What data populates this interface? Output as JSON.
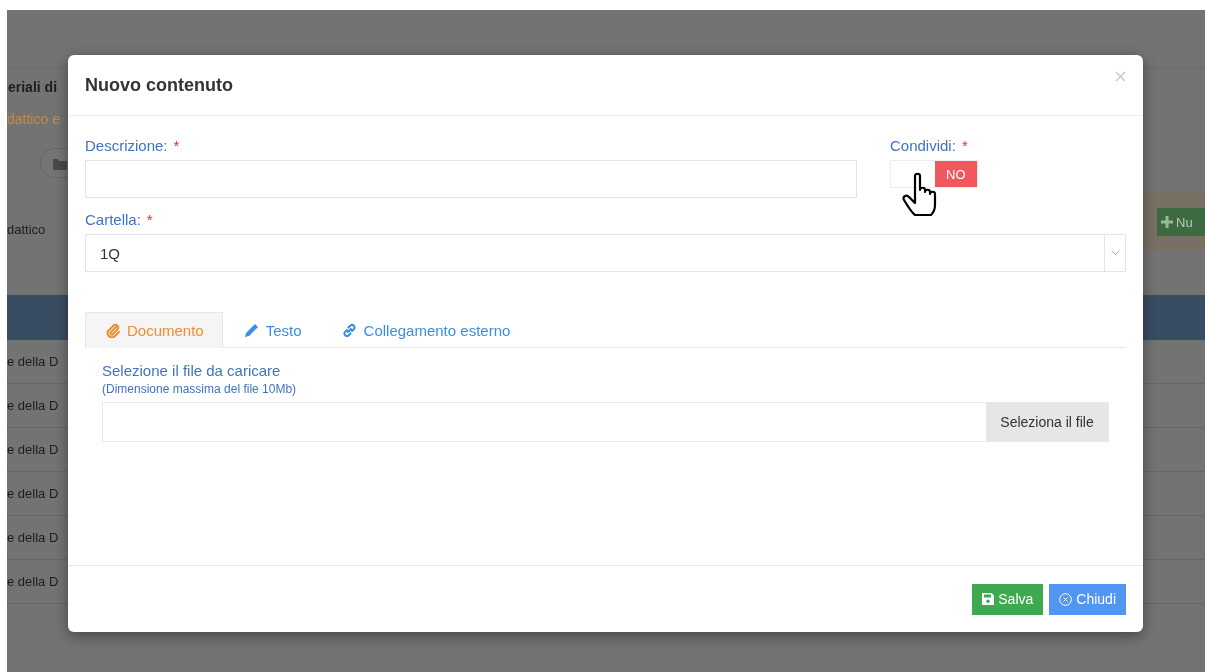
{
  "background_page": {
    "title": "eriali di",
    "subtitle": "dattico e",
    "column_label": "dattico",
    "rows": [
      "e della D",
      "e della D",
      "e della D",
      "e della D",
      "e della D",
      "e della D"
    ],
    "new_button": "Nu"
  },
  "dialog": {
    "title": "Nuovo contenuto",
    "fields": [
      {
        "kind": "text",
        "label": "Descrizione:",
        "required_mark": "*"
      },
      {
        "kind": "select",
        "label": "Cartella:",
        "required_mark": "*",
        "value": "1Q"
      }
    ],
    "share": {
      "label": "Condividi:",
      "required_mark": "*",
      "on": false,
      "state_label": "NO"
    },
    "tabs": [
      {
        "kind": "document",
        "label": "Documento",
        "selected": true
      },
      {
        "kind": "text",
        "label": "Testo",
        "selected": false
      },
      {
        "kind": "link",
        "label": "Collegamento esterno",
        "selected": false
      }
    ],
    "upload": {
      "label": "Selezione il file da caricare",
      "hint": "(Dimensione massima del file 10Mb)",
      "button": "Seleziona il file"
    },
    "buttons": [
      {
        "kind": "save",
        "label": "Salva"
      },
      {
        "kind": "close",
        "label": "Chiudi"
      }
    ]
  }
}
